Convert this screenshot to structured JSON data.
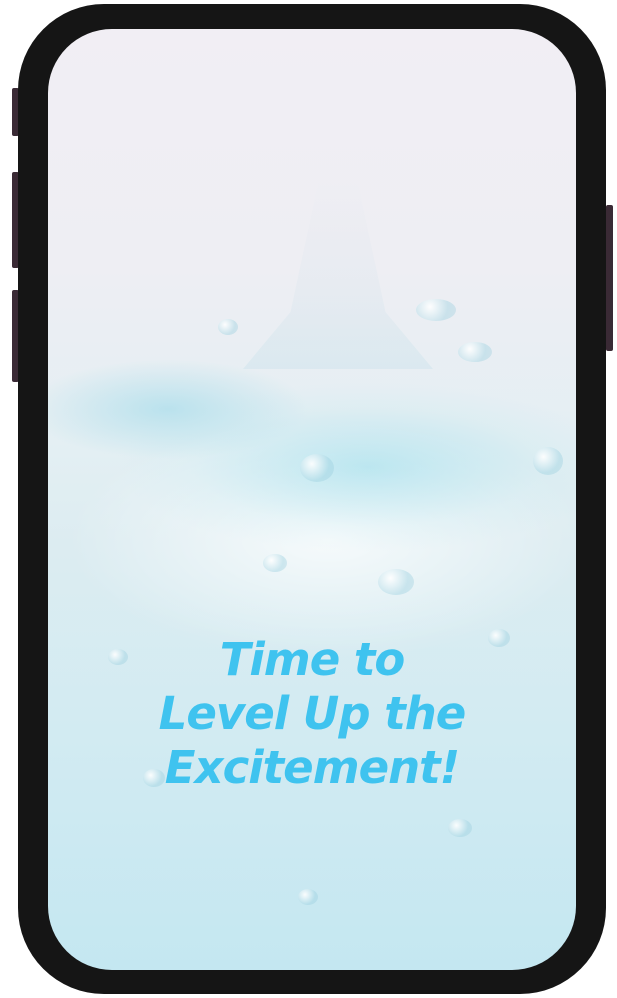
{
  "device": {
    "frame_color": "#151515"
  },
  "screen": {
    "background": "water splash",
    "headline_lines": [
      "Time to",
      "Level Up the",
      "Excitement!"
    ],
    "headline_color": "#3fc3ef"
  }
}
